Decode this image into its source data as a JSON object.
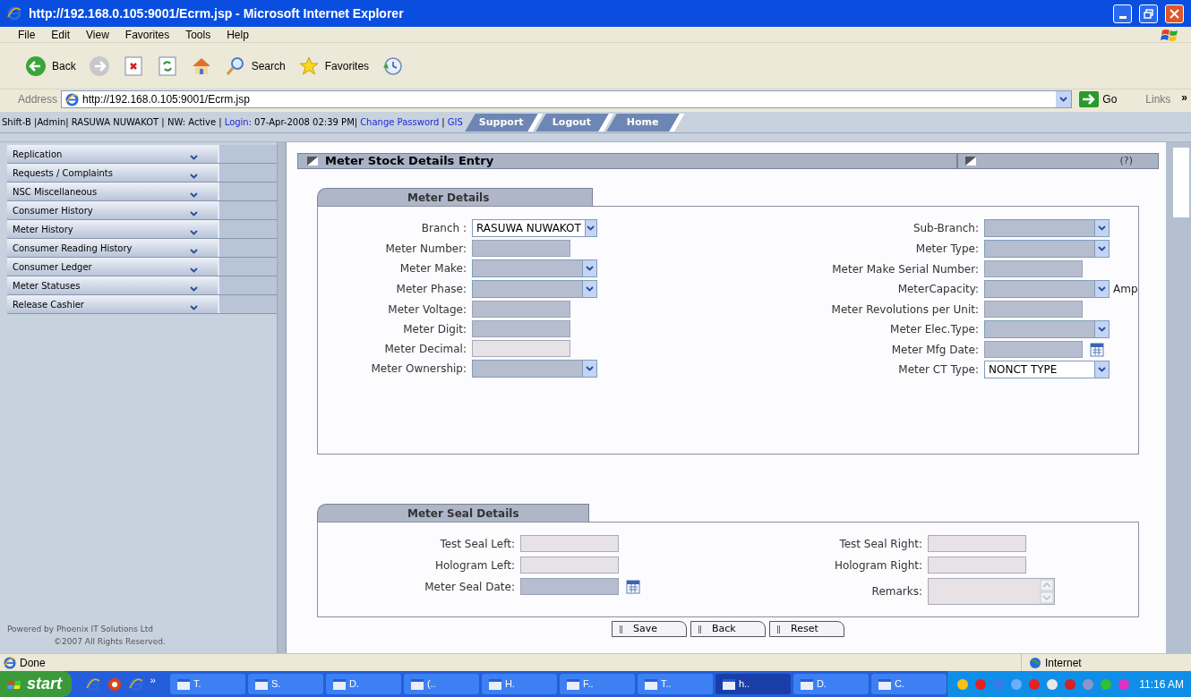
{
  "window": {
    "title": "http://192.168.0.105:9001/Ecrm.jsp - Microsoft Internet Explorer"
  },
  "menu": [
    "File",
    "Edit",
    "View",
    "Favorites",
    "Tools",
    "Help"
  ],
  "toolbar": [
    {
      "kind": "back",
      "label": "Back"
    },
    {
      "kind": "forward"
    },
    {
      "kind": "stop"
    },
    {
      "kind": "refresh"
    },
    {
      "kind": "home"
    },
    {
      "kind": "search",
      "label": "Search"
    },
    {
      "kind": "favorites",
      "label": "Favorites"
    },
    {
      "kind": "history"
    }
  ],
  "address": {
    "label": "Address",
    "value": "http://192.168.0.105:9001/Ecrm.jsp",
    "go": "Go",
    "links": "Links",
    "more": "»"
  },
  "session": [
    {
      "kind": "plain",
      "text": "Shift-B |Admin| RASUWA NUWAKOT | NW: Active |"
    },
    {
      "kind": "link",
      "text": "Login:"
    },
    {
      "kind": "plain",
      "text": "07-Apr-2008 02:39 PM|"
    },
    {
      "kind": "link",
      "text": "Change Password"
    },
    {
      "kind": "plain",
      "text": "|"
    },
    {
      "kind": "link",
      "text": "GIS"
    }
  ],
  "nav_tabs": [
    "Support",
    "Logout",
    "Home"
  ],
  "sidebar": {
    "items": [
      "Replication",
      "Requests / Complaints",
      "NSC Miscellaneous",
      "Consumer History",
      "Meter History",
      "Consumer Reading History",
      "Consumer Ledger",
      "Meter Statuses",
      "Release Cashier"
    ],
    "footer": [
      "Powered by Phoenix IT Solutions Ltd",
      "©2007 All Rights Reserved."
    ]
  },
  "panel": {
    "title": "Meter Stock Details Entry",
    "help": "(?)"
  },
  "sections": [
    {
      "title": "Meter Details",
      "left": [
        {
          "label": "Branch :",
          "kind": "select",
          "value": "RASUWA NUWAKOT"
        },
        {
          "label": "Meter Number:",
          "kind": "text",
          "disabled": false
        },
        {
          "label": "Meter Make:",
          "kind": "select"
        },
        {
          "label": "Meter Phase:",
          "kind": "select"
        },
        {
          "label": "Meter Voltage:",
          "kind": "text",
          "disabled": false
        },
        {
          "label": "Meter Digit:",
          "kind": "text",
          "disabled": false
        },
        {
          "label": "Meter Decimal:",
          "kind": "text",
          "disabled": true
        },
        {
          "label": "Meter Ownership:",
          "kind": "select"
        }
      ],
      "right": [
        {
          "label": "Sub-Branch:",
          "kind": "select"
        },
        {
          "label": "Meter Type:",
          "kind": "select"
        },
        {
          "label": "Meter Make Serial Number:",
          "kind": "text",
          "disabled": false
        },
        {
          "label": "MeterCapacity:",
          "kind": "select",
          "unit": "Amp"
        },
        {
          "label": "Meter Revolutions per Unit:",
          "kind": "text",
          "disabled": false
        },
        {
          "label": "Meter Elec.Type:",
          "kind": "select"
        },
        {
          "label": "Meter Mfg Date:",
          "kind": "date",
          "disabled": false
        },
        {
          "label": "Meter CT Type:",
          "kind": "select",
          "value": "NONCT TYPE"
        }
      ]
    },
    {
      "title": "Meter Seal Details",
      "left": [
        {
          "label": "Test Seal Left:",
          "kind": "text",
          "disabled": true
        },
        {
          "label": "Hologram Left:",
          "kind": "text",
          "disabled": true
        },
        {
          "label": "Meter Seal Date:",
          "kind": "date",
          "disabled": false
        }
      ],
      "right": [
        {
          "label": "Test Seal Right:",
          "kind": "text",
          "disabled": true
        },
        {
          "label": "Hologram Right:",
          "kind": "text",
          "disabled": true
        },
        {
          "label": "Remarks:",
          "kind": "textarea",
          "disabled": true
        }
      ]
    }
  ],
  "buttons": [
    "Save",
    "Back",
    "Reset"
  ],
  "status_bar": {
    "text": "Done",
    "zone": "Internet"
  },
  "taskbar": {
    "start": "start",
    "more": "»",
    "tasks": [
      {
        "label": "T.",
        "selected": false
      },
      {
        "label": "S.",
        "selected": false
      },
      {
        "label": "D.",
        "selected": false
      },
      {
        "label": "(..",
        "selected": false
      },
      {
        "label": "H.",
        "selected": false
      },
      {
        "label": "F..",
        "selected": false
      },
      {
        "label": "T..",
        "selected": false
      },
      {
        "label": "h..",
        "selected": true
      },
      {
        "label": "D.",
        "selected": false
      },
      {
        "label": "C.",
        "selected": false
      }
    ],
    "clock": "11:16 AM"
  }
}
